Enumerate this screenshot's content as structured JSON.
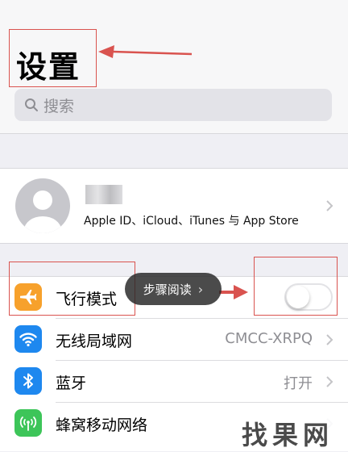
{
  "header": {
    "title": "设置",
    "search_placeholder": "搜索"
  },
  "profile": {
    "subtitle": "Apple ID、iCloud、iTunes 与 App Store"
  },
  "settings_rows": [
    {
      "label": "飞行模式",
      "icon": "airplane-icon",
      "color": "#f7a12c",
      "toggle_on": false
    },
    {
      "label": "无线局域网",
      "icon": "wifi-icon",
      "color": "#1e88ef",
      "value": "CMCC-XRPQ"
    },
    {
      "label": "蓝牙",
      "icon": "bluetooth-icon",
      "color": "#1e88ef",
      "value": "打开"
    },
    {
      "label": "蜂窝移动网络",
      "icon": "cellular-icon",
      "color": "#3dc559"
    }
  ],
  "overlay": {
    "step_reading_label": "步骤阅读",
    "watermark": "找果网"
  },
  "colors": {
    "annotation_red": "#d9534f",
    "ios_blue": "#1e88ef",
    "ios_orange": "#f7a12c",
    "ios_green": "#3dc559"
  }
}
